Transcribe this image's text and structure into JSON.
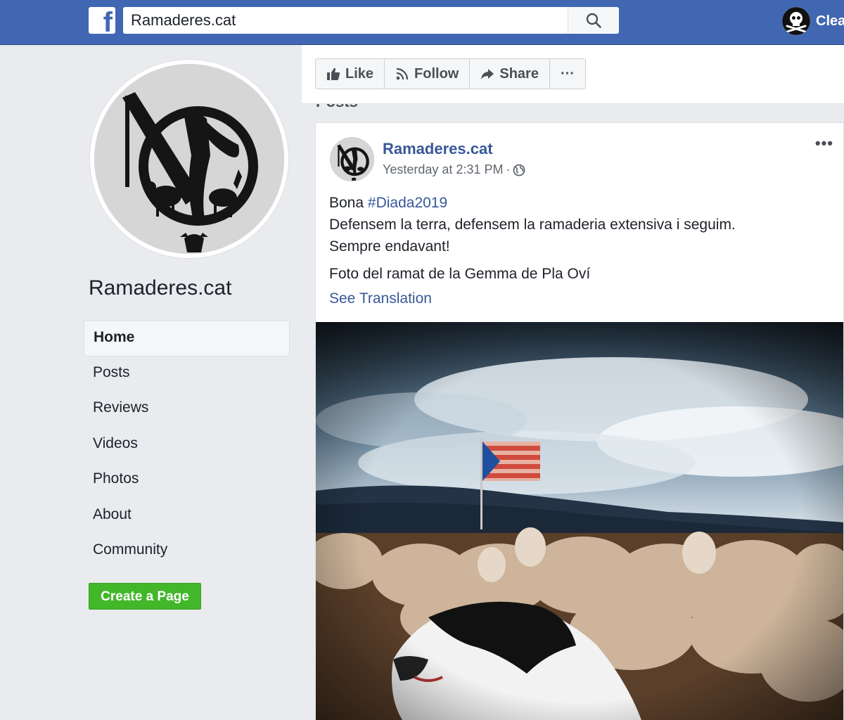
{
  "topbar": {
    "logo_letter": "f",
    "search_value": "Ramaderes.cat",
    "user_name": "Clea"
  },
  "page": {
    "name": "Ramaderes.cat"
  },
  "nav": {
    "items": [
      {
        "label": "Home",
        "active": true
      },
      {
        "label": "Posts"
      },
      {
        "label": "Reviews"
      },
      {
        "label": "Videos"
      },
      {
        "label": "Photos"
      },
      {
        "label": "About"
      },
      {
        "label": "Community"
      }
    ]
  },
  "create_page_label": "Create a Page",
  "actions": {
    "like": "Like",
    "follow": "Follow",
    "share": "Share",
    "more": "···"
  },
  "posts_heading": "Posts",
  "post": {
    "author": "Ramaderes.cat",
    "timestamp": "Yesterday at 2:31 PM",
    "separator": "·",
    "more": "•••",
    "line1_prefix": "Bona ",
    "hashtag": "#Diada2019",
    "line2": "Defensem la terra, defensem la ramaderia extensiva i seguim.",
    "line3": "Sempre endavant!",
    "line4": "Foto del ramat de la Gemma de Pla Oví",
    "see_translation": "See Translation"
  },
  "colors": {
    "topbar": "#4267b2",
    "link": "#385898",
    "create_button": "#42b72a",
    "background": "#e9ebee"
  },
  "icons": {
    "search": "search-icon",
    "like": "thumbs-up-icon",
    "follow": "rss-icon",
    "share": "share-arrow-icon",
    "privacy": "globe-icon",
    "user": "skull-crossbones-icon"
  }
}
